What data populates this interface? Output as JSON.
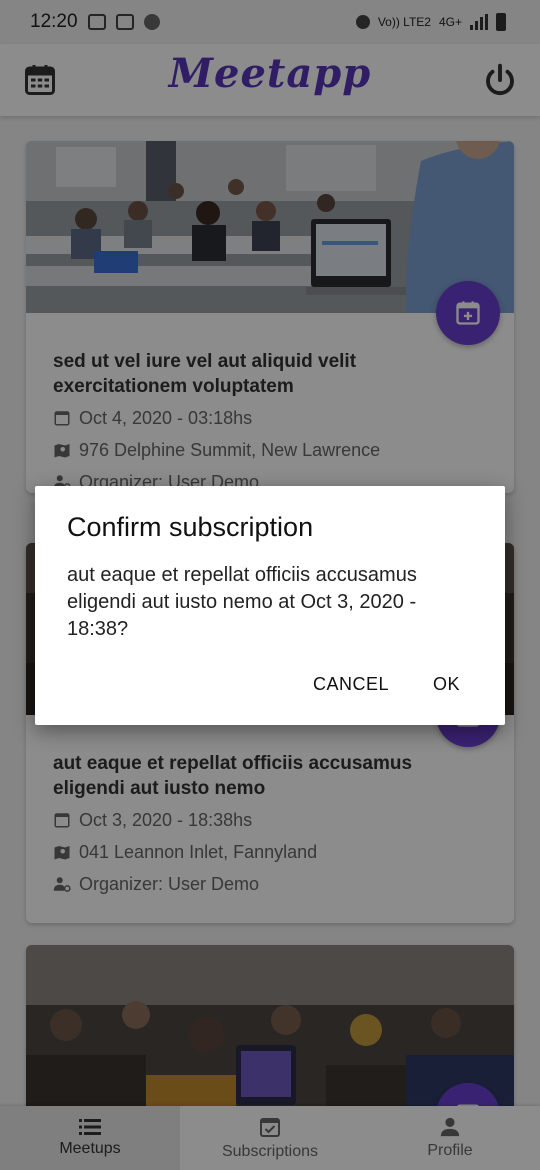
{
  "status_bar": {
    "time": "12:20",
    "network": "4G+",
    "volte": "Vo)) LTE2"
  },
  "header": {
    "app_title": "Meetapp",
    "left_icon": "calendar-icon",
    "right_icon": "power-icon"
  },
  "meetups": [
    {
      "title": "sed ut vel iure vel aut aliquid velit exercitationem voluptatem",
      "date": "Oct 4, 2020 - 03:18hs",
      "location": "976 Delphine Summit, New Lawrence",
      "organizer": "Organizer: User Demo"
    },
    {
      "title": "aut eaque et repellat officiis accusamus eligendi aut iusto nemo",
      "date": "Oct 3, 2020 - 18:38hs",
      "location": "041 Leannon Inlet, Fannyland",
      "organizer": "Organizer: User Demo"
    }
  ],
  "tabs": [
    {
      "label": "Meetups",
      "icon": "list-icon",
      "active": true
    },
    {
      "label": "Subscriptions",
      "icon": "calendar-check-icon",
      "active": false
    },
    {
      "label": "Profile",
      "icon": "person-icon",
      "active": false
    }
  ],
  "dialog": {
    "title": "Confirm subscription",
    "message": "aut eaque et repellat officiis accusamus eligendi aut iusto nemo at Oct 3, 2020 - 18:38?",
    "cancel_label": "CANCEL",
    "ok_label": "OK"
  },
  "colors": {
    "brand": "#5a36b8",
    "fab": "#6b3fd0",
    "scrim": "rgba(0,0,0,0.45)"
  }
}
